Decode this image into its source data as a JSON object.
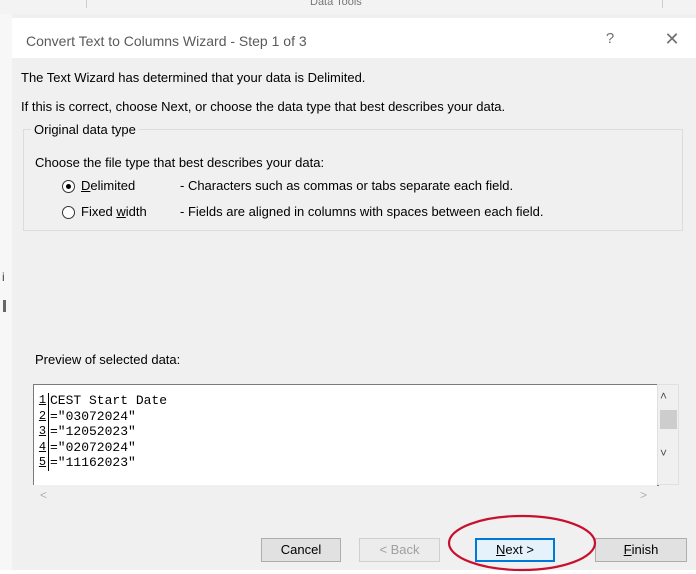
{
  "background": {
    "ribbon_group_label": "Data Tools"
  },
  "dialog": {
    "title": "Convert Text to Columns Wizard - Step 1 of 3",
    "help_glyph": "?",
    "close_glyph": "✕",
    "intro_line_1": "The Text Wizard has determined that your data is Delimited.",
    "intro_line_2": "If this is correct, choose Next, or choose the data type that best describes your data.",
    "original_data_type": {
      "group_title": "Original data type",
      "prompt": "Choose the file type that best describes your data:",
      "options": [
        {
          "label_first": "D",
          "label_rest": "elimited",
          "description": "- Characters such as commas or tabs separate each field.",
          "selected": true
        },
        {
          "label_pre": "Fixed ",
          "label_accel": "w",
          "label_rest": "idth",
          "description": "- Fields are aligned in columns with spaces between each field.",
          "selected": false
        }
      ]
    },
    "preview": {
      "label": "Preview of selected data:",
      "rows": [
        {
          "num": "1",
          "text": "CEST Start Date"
        },
        {
          "num": "2",
          "text": "=\"03072024\""
        },
        {
          "num": "3",
          "text": "=\"12052023\""
        },
        {
          "num": "4",
          "text": "=\"02072024\""
        },
        {
          "num": "5",
          "text": "=\"11162023\""
        }
      ]
    },
    "buttons": {
      "cancel": "Cancel",
      "back": "< Back",
      "next_accel": "N",
      "next_rest": "ext >",
      "finish_accel": "F",
      "finish_rest": "inish"
    }
  },
  "colors": {
    "annotation": "#c8102e",
    "focus_border": "#0078d7"
  }
}
